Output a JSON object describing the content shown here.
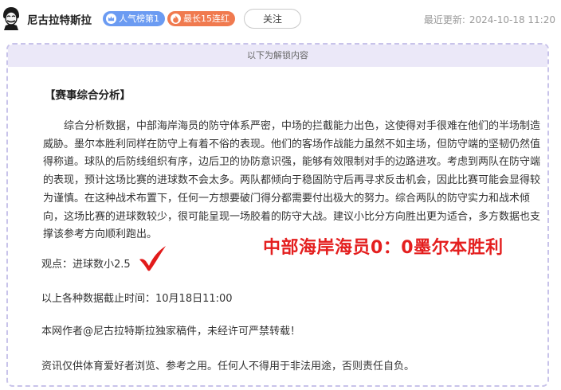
{
  "header": {
    "author_name": "尼古拉特斯拉",
    "badge_hot": "人气榜第1",
    "badge_streak": "最长15连红",
    "follow_label": "关注",
    "update_label": "最近更新:",
    "update_time": "2024-10-18 11:20"
  },
  "article": {
    "unlock_text": "以下为解锁内容",
    "section_title": "【赛事综合分析】",
    "paragraph": "综合分析数据，中部海岸海员的防守体系严密，中场的拦截能力出色，这使得对手很难在他们的半场制造威胁。墨尔本胜利同样在防守上有着不俗的表现。他们的客场作战能力虽然不如主场，但防守端的坚韧仍然值得称道。球队的后防线组织有序，边后卫的协防意识强，能够有效限制对手的边路进攻。考虑到两队在防守端的表现，预计这场比赛的进球数不会太多。两队都倾向于稳固防守后再寻求反击机会，因此比赛可能会显得较为谨慎。在这种战术布置下，任何一方想要破门得分都需要付出极大的努力。综合两队的防守实力和战术倾向，这场比赛的进球数较少，很可能呈现一场胶着的防守大战。建议小比分方向胜出更为适合，多方数据也支撑该参考方向顺利跑出。",
    "score_overlay": "中部海岸海员0：0墨尔本胜利",
    "viewpoint": "观点：进球数小2.5",
    "cutoff": "以上各种数据截止时间：10月18日11:00",
    "copyright": "本网作者@尼古拉特斯拉独家稿件，未经许可严禁转载！",
    "disclaimer": "资讯仅供体育爱好者浏览、参考之用。任何人不得用于非法用途，否则责任自负。"
  },
  "icons": {
    "avatar": "portrait-avatar",
    "hot_badge_icon": "crown-icon",
    "streak_badge_icon": "flame-icon",
    "check": "red-checkmark-icon"
  },
  "colors": {
    "badge_hot": "#6b9bf2",
    "badge_streak": "#f07a4f",
    "unlock_bg": "#ebe8f8",
    "dashed_border": "#c8c3ea",
    "score_red": "#e41f1f",
    "check_red": "#e21b1b"
  }
}
